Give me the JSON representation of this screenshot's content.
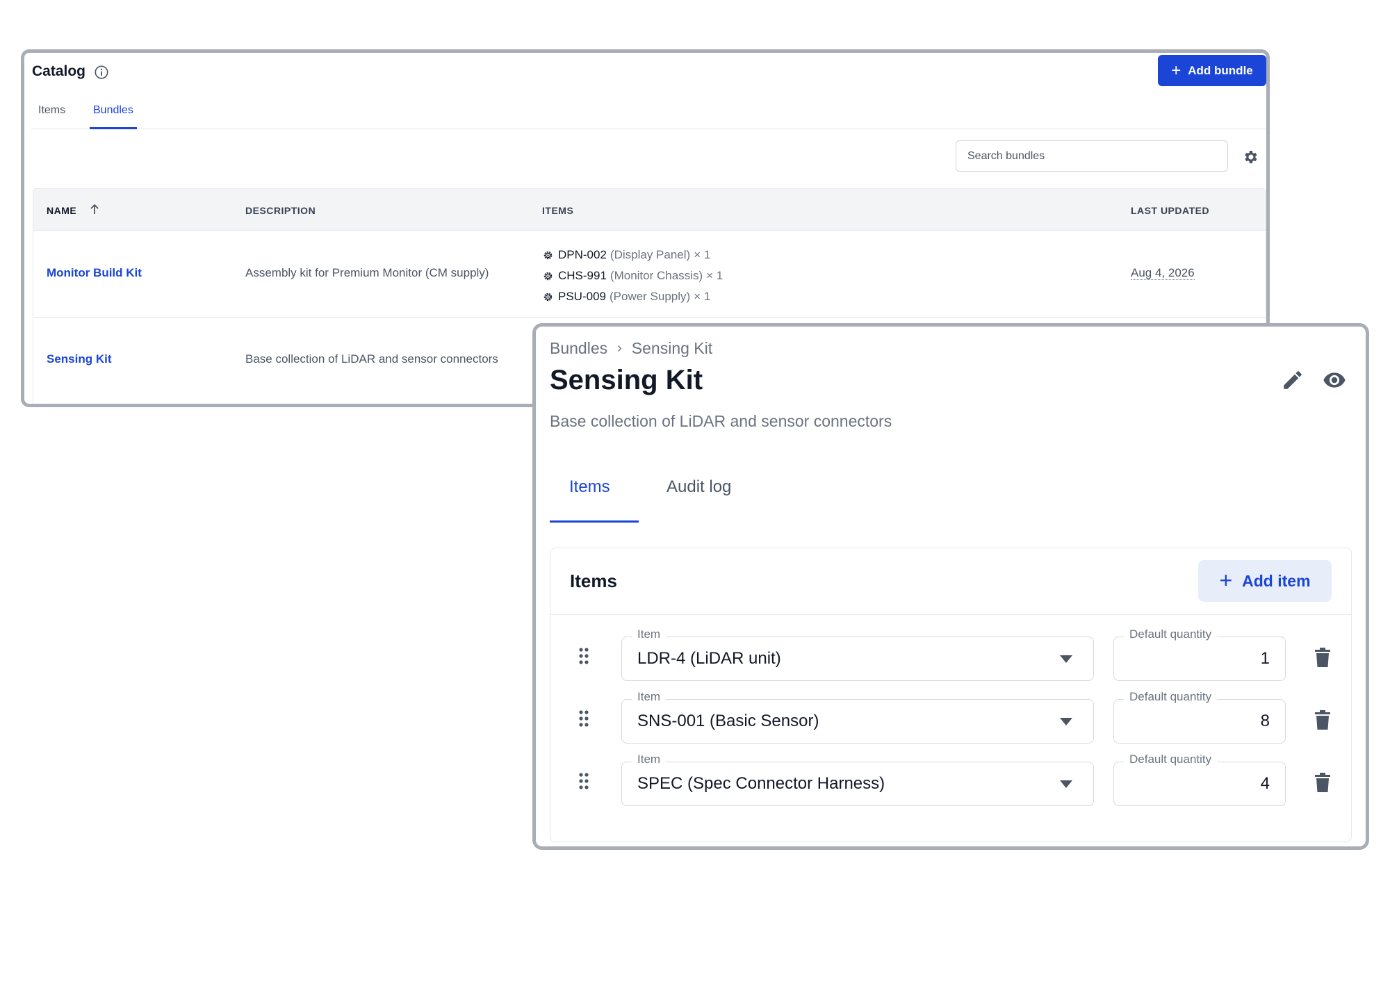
{
  "catalog": {
    "title": "Catalog",
    "add_bundle_label": "Add bundle",
    "tabs": [
      {
        "label": "Items",
        "active": false
      },
      {
        "label": "Bundles",
        "active": true
      }
    ],
    "search": {
      "placeholder": "Search bundles",
      "value": ""
    },
    "table": {
      "columns": [
        "NAME",
        "DESCRIPTION",
        "ITEMS",
        "LAST UPDATED"
      ],
      "sort": {
        "column": "NAME",
        "direction": "ascending"
      },
      "rows": [
        {
          "name": "Monitor Build Kit",
          "description": "Assembly kit for Premium Monitor (CM supply)",
          "items": [
            {
              "code": "DPN-002",
              "name": "(Display Panel)",
              "qty": "× 1"
            },
            {
              "code": "CHS-991",
              "name": "(Monitor Chassis)",
              "qty": "× 1"
            },
            {
              "code": "PSU-009",
              "name": "(Power Supply)",
              "qty": "× 1"
            }
          ],
          "last_updated": "Aug 4, 2026"
        },
        {
          "name": "Sensing Kit",
          "description": "Base collection of LiDAR and sensor connectors"
        }
      ]
    }
  },
  "detail": {
    "breadcrumb": {
      "root": "Bundles",
      "separator": "›",
      "current": "Sensing Kit"
    },
    "title": "Sensing Kit",
    "description": "Base collection of LiDAR and sensor connectors",
    "tabs": [
      {
        "label": "Items",
        "active": true
      },
      {
        "label": "Audit log",
        "active": false
      }
    ],
    "items_card": {
      "title": "Items",
      "add_item_label": "Add item",
      "item_label": "Item",
      "quantity_label": "Default quantity",
      "lines": [
        {
          "item": "LDR-4 (LiDAR unit)",
          "quantity": "1"
        },
        {
          "item": "SNS-001 (Basic Sensor)",
          "quantity": "8"
        },
        {
          "item": "SPEC (Spec Connector Harness)",
          "quantity": "4"
        }
      ]
    }
  },
  "colors": {
    "accent": "#1a45d6",
    "accent_soft": "#e8eef9",
    "window_border": "#a9aeb6",
    "muted_text": "#6b7280"
  },
  "icons": [
    "info-icon",
    "plus-icon",
    "gear-icon",
    "sort-arrow-up-icon",
    "cog-icon",
    "pencil-icon",
    "eye-icon",
    "drag-handle-icon",
    "chevron-down-icon",
    "trash-icon"
  ]
}
